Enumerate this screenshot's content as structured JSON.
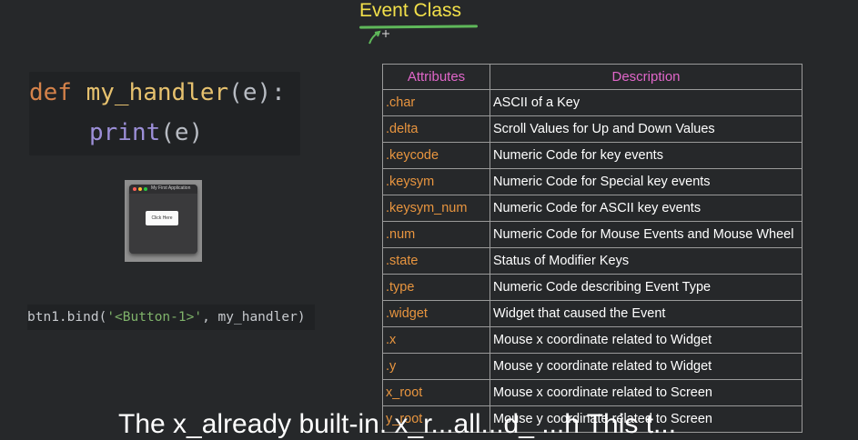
{
  "slide": {
    "title": "Event Class",
    "accent_color": "#f2e04a",
    "underline_color": "#5fb85a"
  },
  "code": {
    "line1": {
      "keyword": "def",
      "function": "my_handler",
      "open": "(e):"
    },
    "line2": {
      "builtin": "print",
      "args": "(e)"
    },
    "bind": {
      "prefix": "btn1.bind(",
      "string": "'<Button-1>'",
      "suffix": ", my_handler)"
    }
  },
  "thumbnail": {
    "window_title": "My First Application",
    "button_label": "Click Here"
  },
  "table": {
    "headers": [
      "Attributes",
      "Description"
    ],
    "rows": [
      {
        "attr": ".char",
        "desc": "ASCII of a Key"
      },
      {
        "attr": ".delta",
        "desc": "Scroll Values for Up and Down Values"
      },
      {
        "attr": ".keycode",
        "desc": "Numeric Code for key events"
      },
      {
        "attr": ".keysym",
        "desc": "Numeric Code for Special key events"
      },
      {
        "attr": ".keysym_num",
        "desc": "Numeric Code for ASCII key events"
      },
      {
        "attr": ".num",
        "desc": "Numeric Code for Mouse Events and Mouse Wheel"
      },
      {
        "attr": ".state",
        "desc": "Status of Modifier Keys"
      },
      {
        "attr": " .type",
        "desc": "Numeric Code describing Event Type"
      },
      {
        "attr": ".widget",
        "desc": "Widget that caused the Event"
      },
      {
        "attr": ".x",
        "desc": "Mouse x coordinate related to Widget"
      },
      {
        "attr": ".y",
        "desc": "Mouse y coordinate related to Widget"
      },
      {
        "attr": "x_root",
        "desc": "Mouse x coordinate related to Screen"
      },
      {
        "attr": "y_root",
        "desc": "Mouse y coordinate related to Screen"
      }
    ]
  },
  "caption": "The x_already built-in. x_r...all...d_ ...h This t..."
}
